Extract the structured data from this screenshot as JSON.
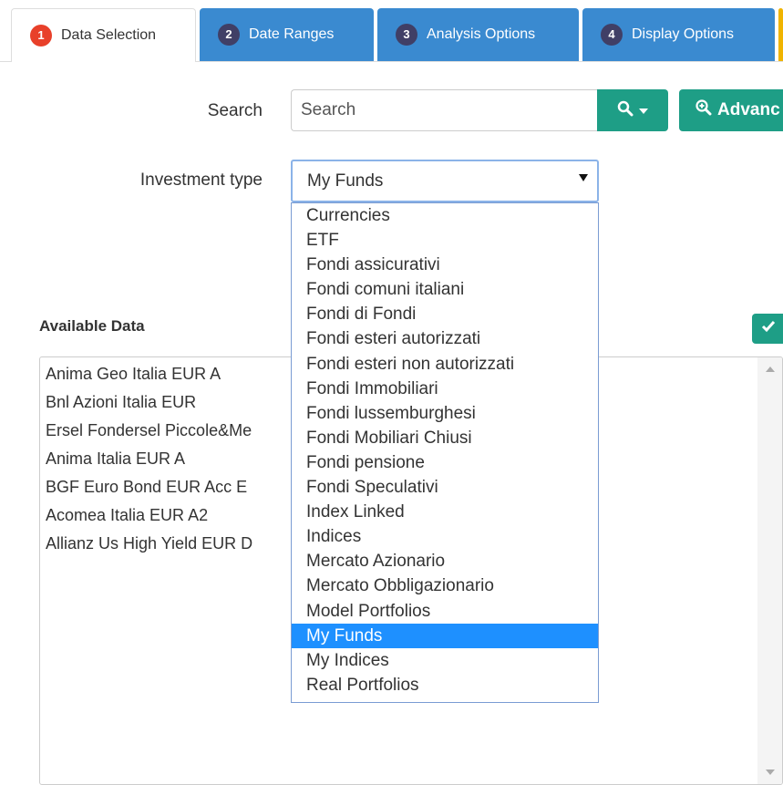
{
  "tabs": [
    {
      "num": "1",
      "label": "Data Selection"
    },
    {
      "num": "2",
      "label": "Date Ranges"
    },
    {
      "num": "3",
      "label": "Analysis Options"
    },
    {
      "num": "4",
      "label": "Display Options"
    }
  ],
  "search": {
    "label": "Search",
    "placeholder": "Search",
    "advanced_label": "Advanc"
  },
  "investment_type": {
    "label": "Investment type",
    "selected": "My Funds",
    "options": [
      "Currencies",
      "ETF",
      "Fondi assicurativi",
      "Fondi comuni italiani",
      "Fondi di Fondi",
      "Fondi esteri autorizzati",
      "Fondi esteri non autorizzati",
      "Fondi Immobiliari",
      "Fondi lussemburghesi",
      "Fondi Mobiliari Chiusi",
      "Fondi pensione",
      "Fondi Speculativi",
      "Index Linked",
      "Indices",
      "Mercato Azionario",
      "Mercato Obbligazionario",
      "Model Portfolios",
      "My Funds",
      "My Indices",
      "Real Portfolios"
    ]
  },
  "available_data": {
    "title": "Available Data",
    "items": [
      "Anima Geo Italia EUR A",
      "Bnl Azioni Italia EUR",
      "Ersel Fondersel Piccole&Me",
      "Anima Italia EUR A",
      "BGF Euro Bond EUR Acc E",
      "Acomea Italia EUR A2",
      "Allianz Us High Yield EUR D"
    ]
  },
  "colors": {
    "accent_green": "#1e9e86",
    "tab_blue": "#3a8ad0",
    "selected_blue": "#1e90ff",
    "active_badge": "#e8402a"
  },
  "icons": {
    "search": "search-icon",
    "caret": "caret-down-icon",
    "advanced": "zoom-plus-icon",
    "confirm": "check-icon"
  }
}
